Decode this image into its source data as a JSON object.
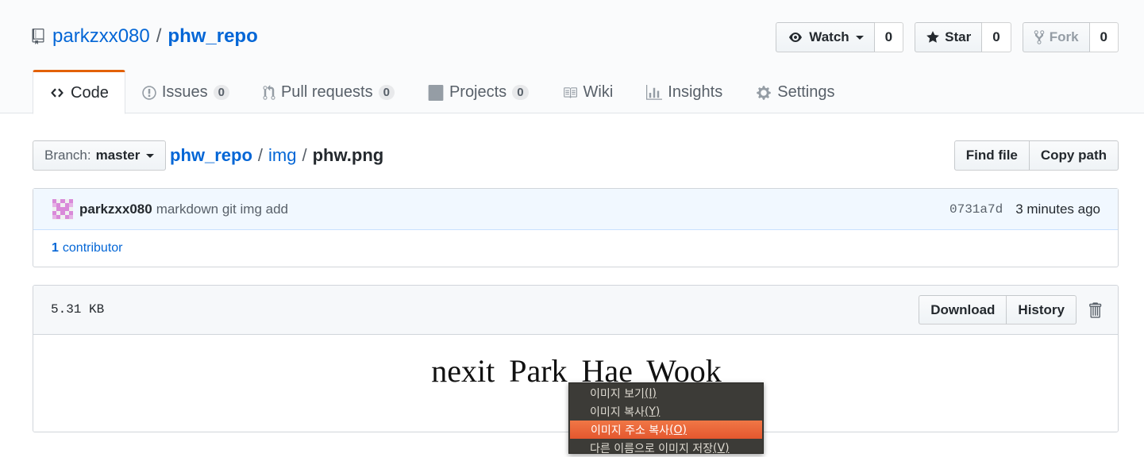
{
  "repo": {
    "owner": "parkzxx080",
    "separator": "/",
    "name": "phw_repo"
  },
  "actions": {
    "watch": {
      "label": "Watch",
      "count": "0"
    },
    "star": {
      "label": "Star",
      "count": "0"
    },
    "fork": {
      "label": "Fork",
      "count": "0"
    }
  },
  "tabs": [
    {
      "label": "Code",
      "icon": "code-icon",
      "selected": true
    },
    {
      "label": "Issues",
      "icon": "issue-icon",
      "count": "0"
    },
    {
      "label": "Pull requests",
      "icon": "pull-request-icon",
      "count": "0"
    },
    {
      "label": "Projects",
      "icon": "project-icon",
      "count": "0"
    },
    {
      "label": "Wiki",
      "icon": "book-icon"
    },
    {
      "label": "Insights",
      "icon": "graph-icon"
    },
    {
      "label": "Settings",
      "icon": "gear-icon"
    }
  ],
  "file_nav": {
    "branch_label": "Branch:",
    "branch_name": "master",
    "breadcrumb": {
      "root": "phw_repo",
      "sep1": "/",
      "folder": "img",
      "sep2": "/",
      "file": "phw.png"
    },
    "find_file": "Find file",
    "copy_path": "Copy path"
  },
  "commit": {
    "author": "parkzxx080",
    "message": "markdown git img add",
    "sha": "0731a7d",
    "time": "3 minutes ago",
    "contributors_count": "1",
    "contributors_label": "contributor"
  },
  "file": {
    "size": "5.31 KB",
    "download": "Download",
    "history": "History",
    "image_text": "nexit Park Hae Wook"
  },
  "context_menu": {
    "items": [
      {
        "text": "이미지 보기",
        "key": "(I)",
        "mnemonic": "I"
      },
      {
        "text": "이미지 복사",
        "key": "(Y)",
        "mnemonic": "Y"
      },
      {
        "text": "이미지 주소 복사",
        "key": "(O)",
        "mnemonic": "O",
        "active": true
      },
      {
        "text": "다른 이름으로 이미지 저장",
        "key": "(V)",
        "mnemonic": "V"
      }
    ]
  },
  "colors": {
    "link": "#0366d6",
    "selected_tab_border": "#e36209",
    "menu_active": "#e95c30",
    "menu_bg": "#3c3b37",
    "commit_bg": "#f1f8ff",
    "avatar_pink": "#d98ad9"
  }
}
